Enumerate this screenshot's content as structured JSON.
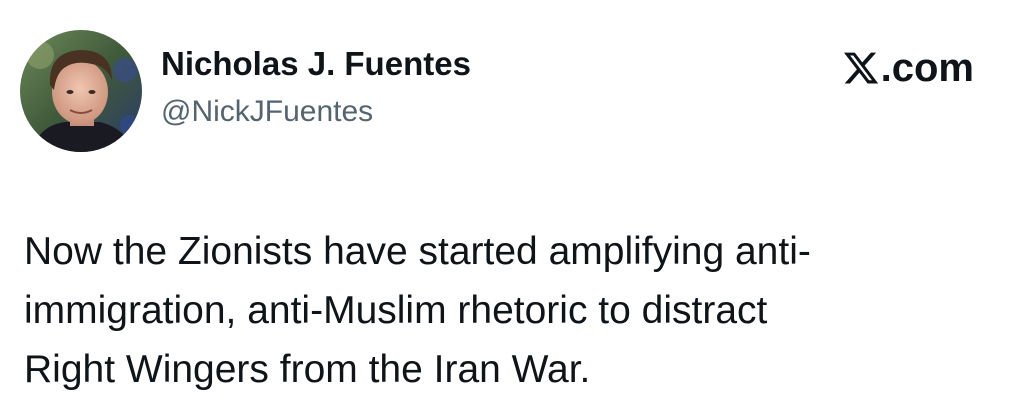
{
  "tweet": {
    "author": {
      "display_name": "Nicholas J. Fuentes",
      "handle": "@NickJFuentes",
      "avatar_icon": "profile-photo"
    },
    "source": {
      "logo_icon": "x-logo-icon",
      "suffix": ".com"
    },
    "text": "Now the Zionists have started amplifying anti-\nimmigration, anti-Muslim rhetoric to distract\nRight Wingers from the Iran War."
  }
}
